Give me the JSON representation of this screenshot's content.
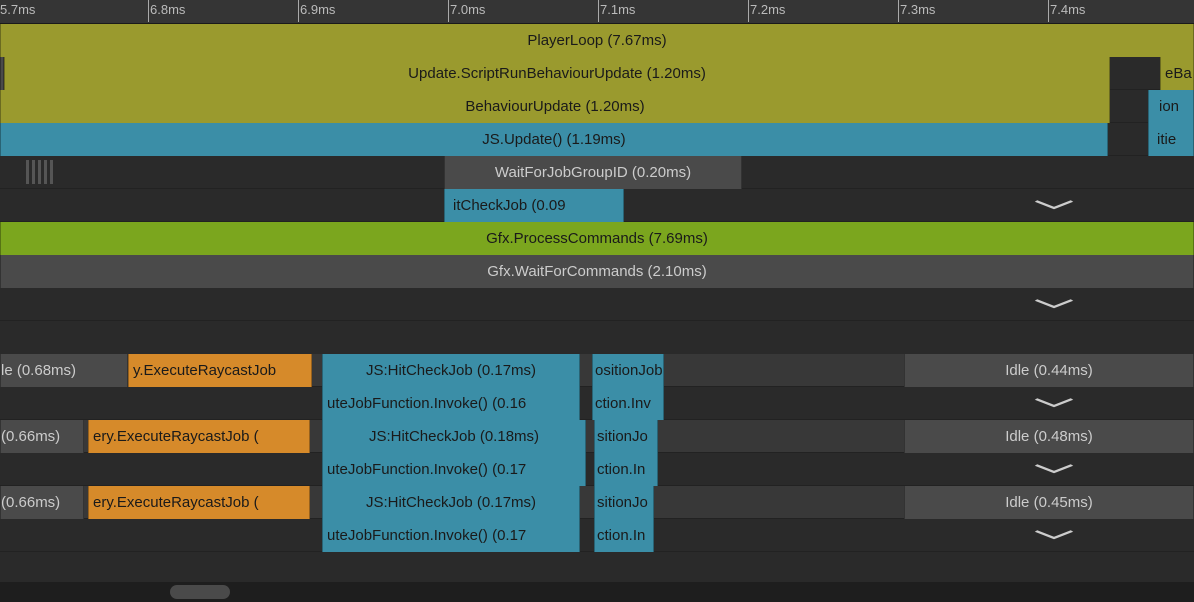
{
  "ruler": {
    "ticks": [
      "5.7ms",
      "6.8ms",
      "6.9ms",
      "7.0ms",
      "7.1ms",
      "7.2ms",
      "7.3ms",
      "7.4ms"
    ]
  },
  "mainThread": {
    "playerLoop": "PlayerLoop (7.67ms)",
    "scriptRun": "Update.ScriptRunBehaviourUpdate (1.20ms)",
    "eBa": "eBa",
    "behaviourUpdate": "BehaviourUpdate (1.20ms)",
    "ion": "ion",
    "jsUpdate": "JS.Update() (1.19ms)",
    "itie": "itie",
    "waitJob": "WaitForJobGroupID (0.20ms)",
    "hitCheck": "itCheckJob (0.09"
  },
  "gfx": {
    "process": "Gfx.ProcessCommands (7.69ms)",
    "wait": "Gfx.WaitForCommands (2.10ms)"
  },
  "workers": [
    {
      "idle1": "le (0.68ms)",
      "raycast": "y.ExecuteRaycastJob",
      "hitCheck": "JS:HitCheckJob (0.17ms)",
      "position": "ositionJob",
      "idle2": "Idle (0.44ms)",
      "invoke": "uteJobFunction.Invoke() (0.16",
      "invoke2": "ction.Inv"
    },
    {
      "idle1": "(0.66ms)",
      "raycast": "ery.ExecuteRaycastJob (",
      "hitCheck": "JS:HitCheckJob (0.18ms)",
      "position": "sitionJo",
      "idle2": "Idle (0.48ms)",
      "invoke": "uteJobFunction.Invoke() (0.17",
      "invoke2": "ction.In"
    },
    {
      "idle1": "(0.66ms)",
      "raycast": "ery.ExecuteRaycastJob (",
      "hitCheck": "JS:HitCheckJob (0.17ms)",
      "position": "sitionJo",
      "idle2": "Idle (0.45ms)",
      "invoke": "uteJobFunction.Invoke() (0.17",
      "invoke2": "ction.In"
    }
  ]
}
